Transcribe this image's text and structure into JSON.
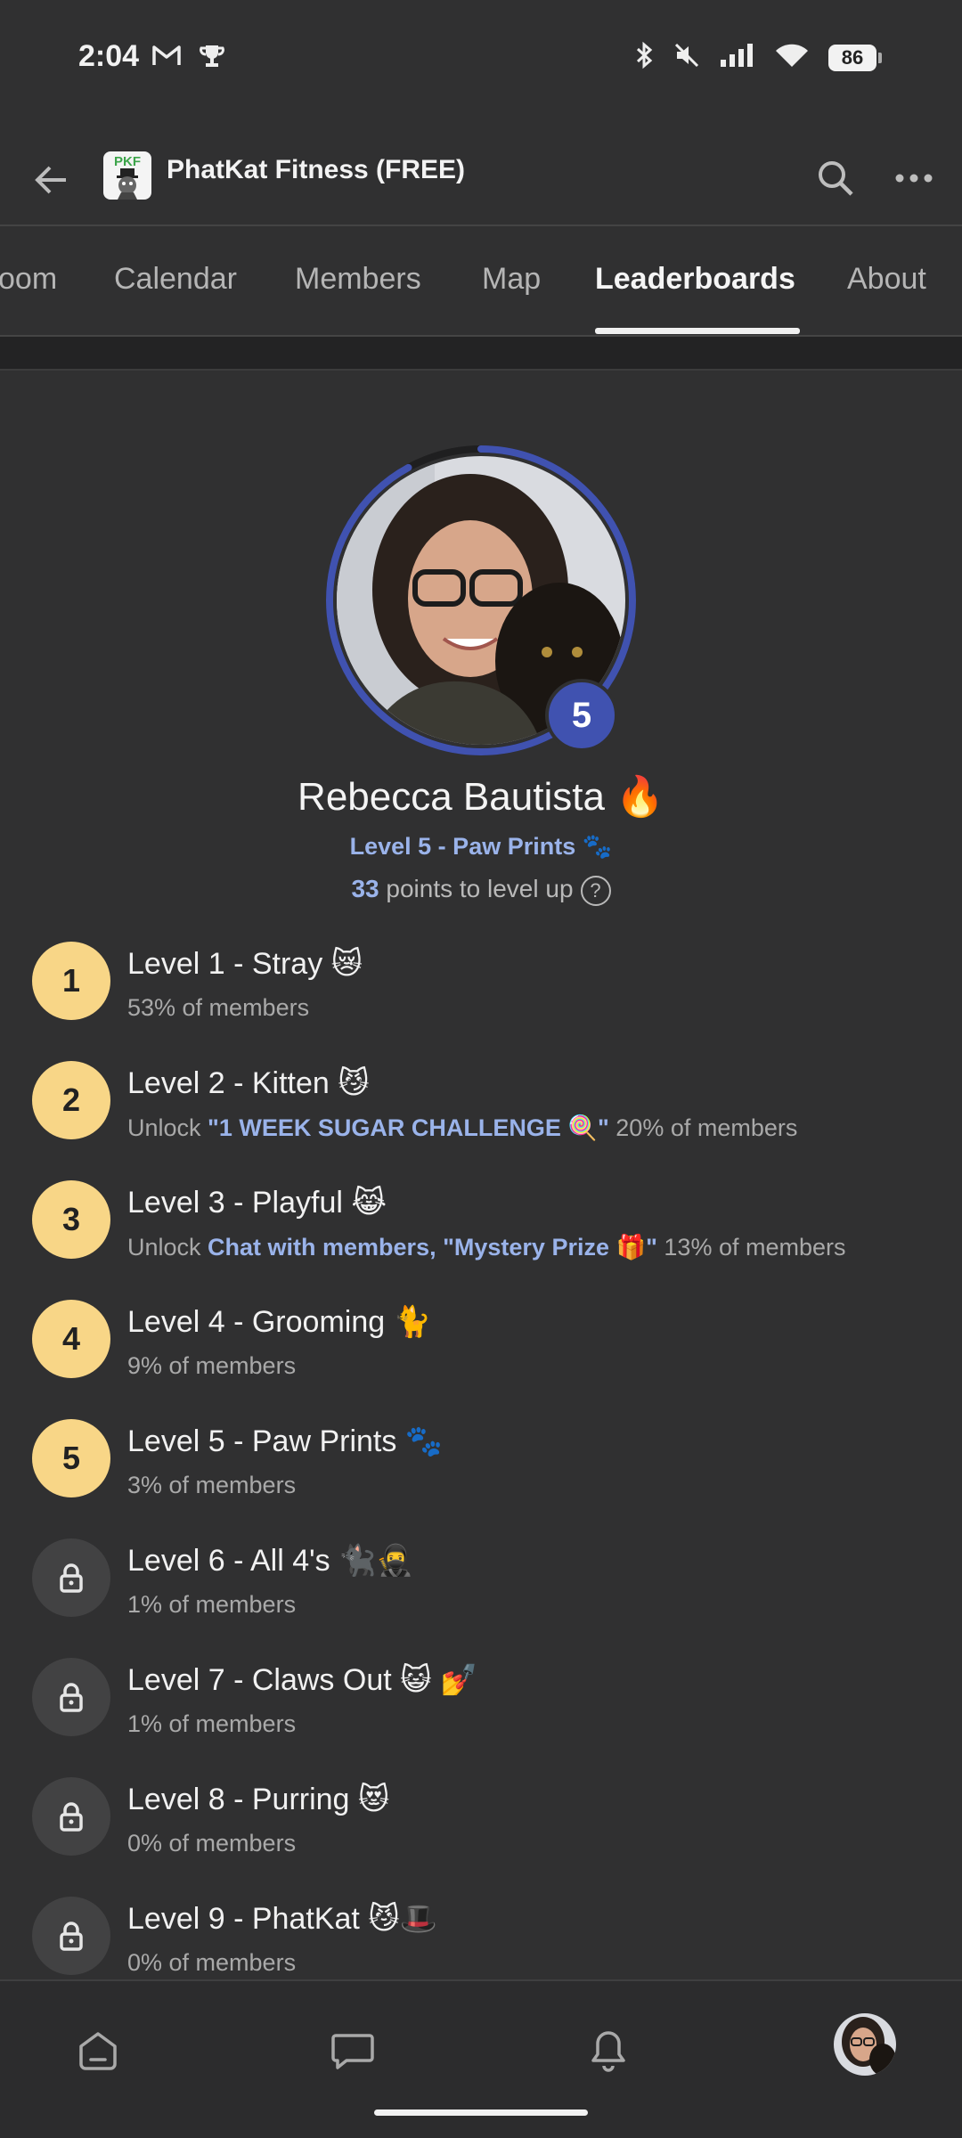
{
  "status_bar": {
    "time": "2:04",
    "battery": "86"
  },
  "header": {
    "group_title": "PhatKat Fitness (FREE)",
    "logo_text": "PKF"
  },
  "tabs": [
    {
      "label": "oom"
    },
    {
      "label": "Calendar"
    },
    {
      "label": "Members"
    },
    {
      "label": "Map"
    },
    {
      "label": "Leaderboards",
      "active": true
    },
    {
      "label": "About"
    }
  ],
  "profile": {
    "name": "Rebecca Bautista 🔥",
    "level_label": "Level 5 - Paw Prints 🐾",
    "points": "33",
    "points_suffix": " points to level up",
    "level_number": "5",
    "progress_fraction": 0.92
  },
  "levels": [
    {
      "number": "1",
      "name": "Level 1 - Stray 😿",
      "unlock_prefix": "",
      "unlock_text": "",
      "members": "53% of members",
      "locked": false
    },
    {
      "number": "2",
      "name": "Level 2 - Kitten 😼",
      "unlock_prefix": "Unlock ",
      "unlock_text": "\"1 WEEK SUGAR CHALLENGE 🍭\"",
      "members": " 20% of members",
      "locked": false
    },
    {
      "number": "3",
      "name": "Level 3 - Playful 😹",
      "unlock_prefix": "Unlock ",
      "unlock_text": "Chat with members, \"Mystery Prize 🎁\"",
      "members": " 13% of members",
      "locked": false
    },
    {
      "number": "4",
      "name": "Level 4 - Grooming 🐈",
      "unlock_prefix": "",
      "unlock_text": "",
      "members": "9% of members",
      "locked": false
    },
    {
      "number": "5",
      "name": "Level 5 - Paw Prints 🐾",
      "unlock_prefix": "",
      "unlock_text": "",
      "members": "3% of members",
      "locked": false
    },
    {
      "number": "6",
      "name": "Level 6 - All 4's 🐈‍⬛🥷",
      "unlock_prefix": "",
      "unlock_text": "",
      "members": "1% of members",
      "locked": true
    },
    {
      "number": "7",
      "name": "Level 7 - Claws Out 😺 💅",
      "unlock_prefix": "",
      "unlock_text": "",
      "members": "1% of members",
      "locked": true
    },
    {
      "number": "8",
      "name": "Level 8 - Purring 😻",
      "unlock_prefix": "",
      "unlock_text": "",
      "members": "0% of members",
      "locked": true
    },
    {
      "number": "9",
      "name": "Level 9 - PhatKat 😼🎩",
      "unlock_prefix": "",
      "unlock_text": "",
      "members": "0% of members",
      "locked": true
    }
  ],
  "bottom_nav": [
    {
      "icon": "home-icon"
    },
    {
      "icon": "chat-icon"
    },
    {
      "icon": "bell-icon"
    },
    {
      "icon": "profile-avatar"
    }
  ],
  "colors": {
    "accent": "#9ab3ea",
    "ring": "#4052b0",
    "level_circle": "#f8d687",
    "background": "#303031"
  }
}
